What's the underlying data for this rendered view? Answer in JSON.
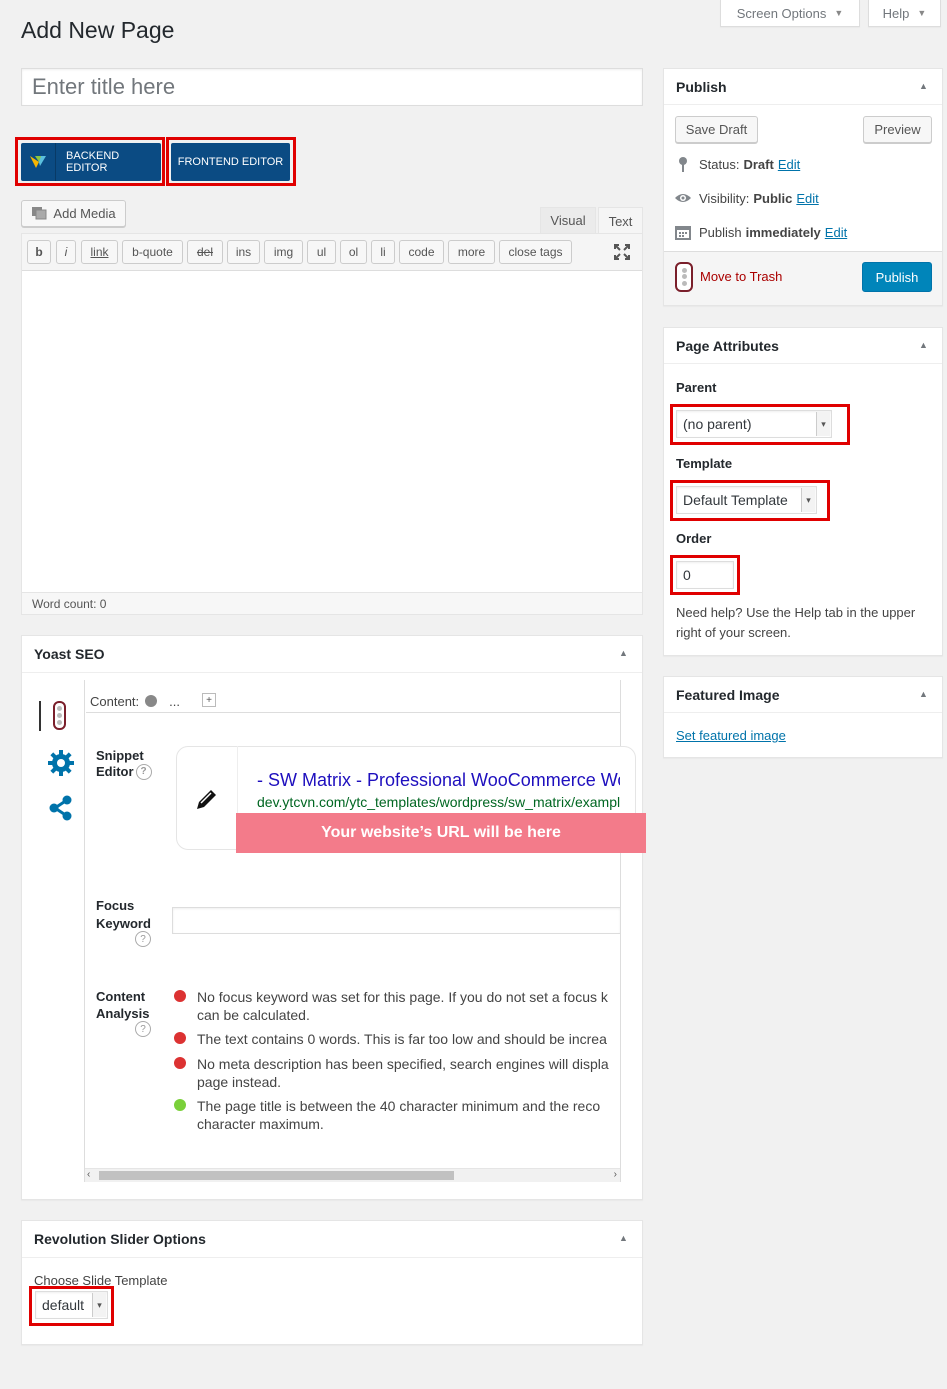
{
  "header": {
    "page_title": "Add New Page",
    "screen_options": "Screen Options",
    "help": "Help"
  },
  "title_field": {
    "placeholder": "Enter title here"
  },
  "editor_buttons": {
    "backend": "BACKEND EDITOR",
    "frontend": "FRONTEND EDITOR"
  },
  "editor": {
    "add_media": "Add Media",
    "tab_visual": "Visual",
    "tab_text": "Text",
    "quicktags": [
      "b",
      "i",
      "link",
      "b-quote",
      "del",
      "ins",
      "img",
      "ul",
      "ol",
      "li",
      "code",
      "more",
      "close tags"
    ],
    "word_count": "Word count: 0"
  },
  "yoast": {
    "title": "Yoast SEO",
    "content_label": "Content:",
    "ellipsis": "...",
    "plus": "+",
    "snippet_label_1": "Snippet",
    "snippet_label_2": "Editor",
    "snippet_title": "- SW Matrix - Professional WooCommerce Wo",
    "snippet_url": "dev.ytcvn.com/ytc_templates/wordpress/sw_matrix/exampl",
    "url_banner": "Your website’s URL will be here",
    "focus_label_1": "Focus",
    "focus_label_2": "Keyword",
    "analysis_label_1": "Content",
    "analysis_label_2": "Analysis",
    "analysis": [
      {
        "color": "#dc3232",
        "lines": [
          "No focus keyword was set for this page. If you do not set a focus k",
          "can be calculated."
        ]
      },
      {
        "color": "#dc3232",
        "lines": [
          "The text contains 0 words. This is far too low and should be increa"
        ]
      },
      {
        "color": "#dc3232",
        "lines": [
          "No meta description has been specified, search engines will displa",
          "page instead."
        ]
      },
      {
        "color": "#7ad03a",
        "lines": [
          "The page title is between the 40 character minimum and the reco",
          "character maximum."
        ]
      }
    ]
  },
  "revslider": {
    "title": "Revolution Slider Options",
    "label": "Choose Slide Template",
    "value": "default"
  },
  "publish": {
    "title": "Publish",
    "save_draft": "Save Draft",
    "preview": "Preview",
    "status_label": "Status:",
    "status_value": "Draft",
    "edit": "Edit",
    "visibility_label": "Visibility:",
    "visibility_value": "Public",
    "publish_label": "Publish",
    "publish_value": "immediately",
    "trash": "Move to Trash",
    "publish_btn": "Publish"
  },
  "attributes": {
    "title": "Page Attributes",
    "parent_label": "Parent",
    "parent_value": "(no parent)",
    "template_label": "Template",
    "template_value": "Default Template",
    "order_label": "Order",
    "order_value": "0",
    "help_line1": "Need help? Use the Help tab in the upper",
    "help_line2": "right of your screen."
  },
  "featured": {
    "title": "Featured Image",
    "link": "Set featured image"
  },
  "colors": {
    "wp_blue": "#0073aa",
    "publish_btn": "#0085ba",
    "vc_blue": "#0b4b83",
    "highlight_red": "#e00000",
    "banner": "#f37b8a",
    "yoast_title": "#1e0fbe",
    "yoast_url": "#006621"
  }
}
